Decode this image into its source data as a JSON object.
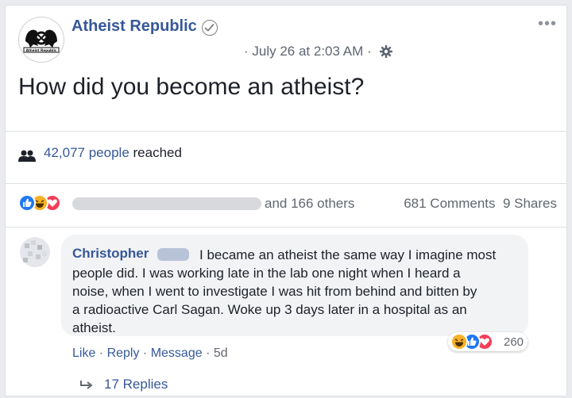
{
  "post": {
    "page_name": "Atheist Republic",
    "logo_text": "Atheist Republic",
    "timestamp": "· July 26 at 2:03 AM ·",
    "text": "How did you become an atheist?",
    "reach_count": "42,077 people",
    "reach_suffix": " reached",
    "reactions_others": "and 166 others",
    "comments_count": "681 Comments",
    "shares_count": "9 Shares"
  },
  "comment": {
    "author": "Christopher",
    "lines": [
      "I became an atheist the same way I imagine most",
      "people did. I was working late in the lab one night when I heard a",
      "noise, when I went to investigate I was hit from behind and bitten by",
      "a radioactive Carl Sagan. Woke up 3 days later in a hospital as an",
      "atheist."
    ],
    "reaction_count": "260",
    "actions": {
      "like": "Like",
      "reply": "Reply",
      "message": "Message",
      "time": "5d",
      "sep": " · "
    },
    "replies": "17 Replies"
  },
  "icons": {
    "verified": "verified-check-icon",
    "gear": "gear-icon",
    "more": "more-icon",
    "reach": "people-icon",
    "reply_arrow": "reply-arrow-icon",
    "like_reaction": "like-reaction-icon",
    "haha_reaction": "haha-reaction-icon",
    "love_reaction": "love-reaction-icon"
  },
  "colors": {
    "link": "#365899",
    "like": "#2078f4",
    "haha": "#f7b125",
    "love": "#f33e58"
  }
}
